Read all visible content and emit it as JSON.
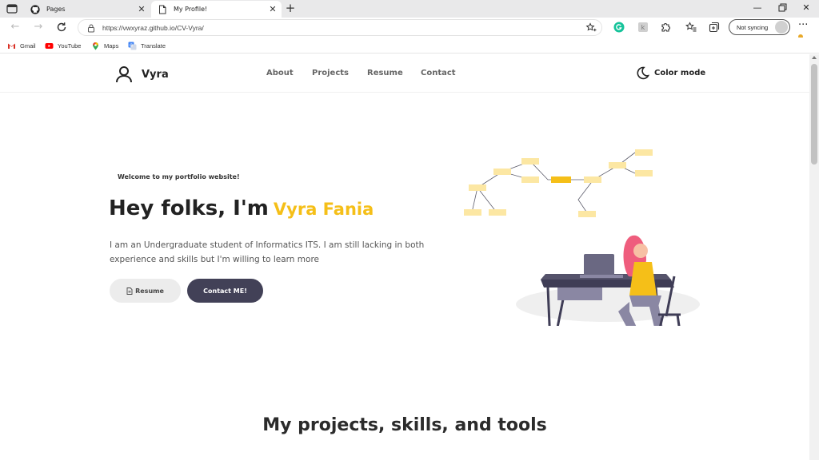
{
  "browser": {
    "tabs": [
      {
        "title": "Pages",
        "icon": "github-icon"
      },
      {
        "title": "My Profile!",
        "icon": "page-icon"
      }
    ],
    "url": "https://vwxyraz.github.io/CV-Vyra/",
    "sync_label": "Not syncing",
    "bookmarks": [
      {
        "label": "Gmail",
        "icon": "gmail-icon"
      },
      {
        "label": "YouTube",
        "icon": "youtube-icon"
      },
      {
        "label": "Maps",
        "icon": "maps-icon"
      },
      {
        "label": "Translate",
        "icon": "translate-icon"
      }
    ]
  },
  "site": {
    "brand": "Vyra",
    "nav": [
      "About",
      "Projects",
      "Resume",
      "Contact"
    ],
    "color_mode": "Color mode"
  },
  "hero": {
    "welcome": "Welcome to my portfolio website!",
    "greeting": "Hey folks, I'm",
    "name": "Vyra Fania",
    "description": "I am an Undergraduate student of Informatics ITS. I am still lacking in both experience and skills but I'm willing to learn more",
    "resume_label": "Resume",
    "contact_label": "Contact ME!"
  },
  "section": {
    "title": "My projects, skills, and tools"
  },
  "colors": {
    "accent": "#f5bf18",
    "button_dark": "#424157",
    "button_light": "#ececec"
  }
}
